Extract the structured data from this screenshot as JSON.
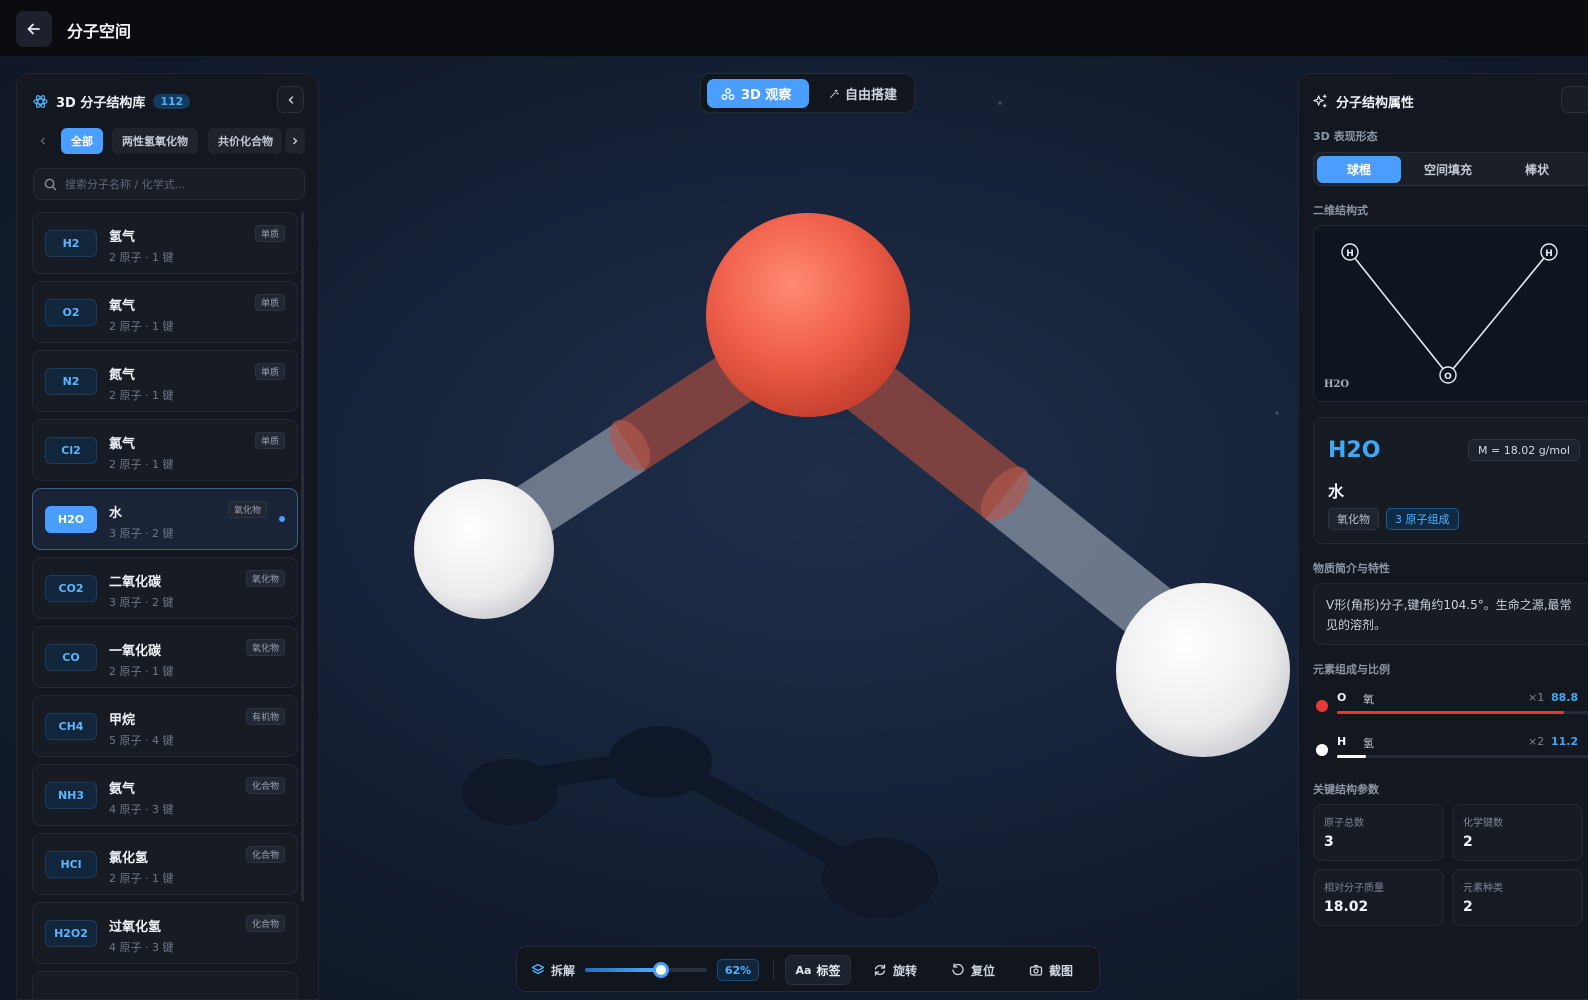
{
  "app": {
    "title": "分子空间"
  },
  "library": {
    "title": "3D 分子结构库",
    "count": "112",
    "filters": [
      "全部",
      "两性氢氧化物",
      "共价化合物"
    ],
    "search_placeholder": "搜索分子名称 / 化学式...",
    "molecules": [
      {
        "formula": "H2",
        "name": "氢气",
        "meta": "2 原子 · 1 键",
        "category": "单质"
      },
      {
        "formula": "O2",
        "name": "氧气",
        "meta": "2 原子 · 1 键",
        "category": "单质"
      },
      {
        "formula": "N2",
        "name": "氮气",
        "meta": "2 原子 · 1 键",
        "category": "单质"
      },
      {
        "formula": "Cl2",
        "name": "氯气",
        "meta": "2 原子 · 1 键",
        "category": "单质"
      },
      {
        "formula": "H2O",
        "name": "水",
        "meta": "3 原子 · 2 键",
        "category": "氧化物"
      },
      {
        "formula": "CO2",
        "name": "二氧化碳",
        "meta": "3 原子 · 2 键",
        "category": "氧化物"
      },
      {
        "formula": "CO",
        "name": "一氧化碳",
        "meta": "2 原子 · 1 键",
        "category": "氧化物"
      },
      {
        "formula": "CH4",
        "name": "甲烷",
        "meta": "5 原子 · 4 键",
        "category": "有机物"
      },
      {
        "formula": "NH3",
        "name": "氨气",
        "meta": "4 原子 · 3 键",
        "category": "化合物"
      },
      {
        "formula": "HCl",
        "name": "氯化氢",
        "meta": "2 原子 · 1 键",
        "category": "化合物"
      },
      {
        "formula": "H2O2",
        "name": "过氧化氢",
        "meta": "4 原子 · 3 键",
        "category": "化合物"
      }
    ],
    "selected_index": 4
  },
  "viewer": {
    "modes": [
      "3D 观察",
      "自由搭建"
    ],
    "active_mode": "3D 观察",
    "toolbar": {
      "explode_label": "拆解",
      "explode_value": 62,
      "explode_display": "62%",
      "labels_prefix": "Aa",
      "labels_label": "标签",
      "rotate_label": "旋转",
      "reset_label": "复位",
      "screenshot_label": "截图"
    }
  },
  "properties": {
    "title": "分子结构属性",
    "style_section": "3D 表现形态",
    "styles": [
      "球棍",
      "空间填充",
      "棒状"
    ],
    "active_style": "球棍",
    "structure_section": "二维结构式",
    "structure_caption": "H2O",
    "atom_labels": [
      "H",
      "H",
      "O"
    ],
    "formula": "H2O",
    "molar_mass": "M = 18.02 g/mol",
    "name": "水",
    "tags": [
      "氧化物",
      "3 原子组成"
    ],
    "desc_section": "物质简介与特性",
    "description": "V形(角形)分子,键角约104.5°。生命之源,最常见的溶剂。",
    "composition_section": "元素组成与比例",
    "elements": [
      {
        "symbol": "O",
        "name": "氧",
        "count": "×1",
        "percent": "88.8",
        "fraction": 0.888,
        "color": "#e53935"
      },
      {
        "symbol": "H",
        "name": "氢",
        "count": "×2",
        "percent": "11.2",
        "fraction": 0.112,
        "color": "#ffffff"
      }
    ],
    "params_section": "关键结构参数",
    "params": [
      {
        "label": "原子总数",
        "value": "3"
      },
      {
        "label": "化学键数",
        "value": "2"
      },
      {
        "label": "相对分子质量",
        "value": "18.02"
      },
      {
        "label": "元素种类",
        "value": "2"
      }
    ]
  },
  "colors": {
    "accent": "#4a9eff",
    "oxygen": "#f0604c",
    "hydrogen": "#f2f2f2"
  }
}
